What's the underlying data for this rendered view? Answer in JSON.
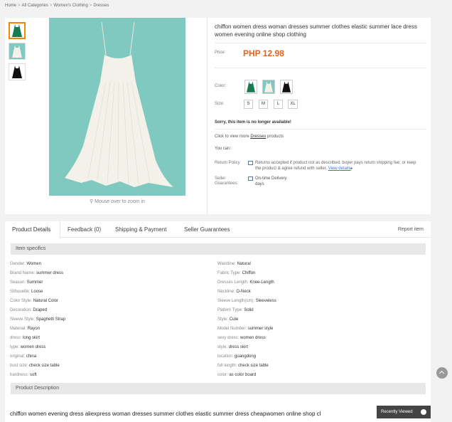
{
  "breadcrumb": {
    "home": "Home",
    "categories": "All Categories",
    "clothing": "Women's Clothing",
    "current": "Dresses",
    "sep": ">"
  },
  "product": {
    "title": "chiffon women dress woman dresses summer clothes elastic summer lace dress women evening online shop clothing",
    "price_label": "Price:",
    "price": "PHP 12.98",
    "color_label": "Color:",
    "size_label": "Size:",
    "sizes": [
      "S",
      "M",
      "L",
      "XL"
    ],
    "unavailable": "Sorry, this item is no longer available!",
    "click_prefix": "Click to view more ",
    "click_link": "Dresses",
    "click_suffix": " products",
    "you_can": "You can:",
    "return_label": "Return Policy",
    "return_text": "Returns accepted if product not as described, buyer pays return shipping fee; or keep the product & agree refund with seller.",
    "view_details": "View details",
    "guarantee_label": "Seller Guarantees:",
    "guarantee_line1": "On-time Delivery",
    "guarantee_line2": "days",
    "zoom_hint": "Mouse over to zoom in"
  },
  "colors": {
    "teal_bg": "#80c9c0",
    "price": "#e8601c",
    "active_border": "#f08a00",
    "link": "#3a7ac8"
  },
  "tabs": {
    "details": "Product Details",
    "feedback": "Feedback (0)",
    "shipping": "Shipping & Payment",
    "guarantees": "Seller Guarantees",
    "report": "Report item"
  },
  "specifics_title": "Item specifics",
  "specs_left": [
    {
      "k": "Gender:",
      "v": "Women"
    },
    {
      "k": "Brand Name:",
      "v": "summer dress"
    },
    {
      "k": "Season:",
      "v": "Summer"
    },
    {
      "k": "Silhouette:",
      "v": "Loose"
    },
    {
      "k": "Color Style:",
      "v": "Natural Color"
    },
    {
      "k": "Decoration:",
      "v": "Draped"
    },
    {
      "k": "Sleeve Style:",
      "v": "Spaghetti Strap"
    },
    {
      "k": "Material:",
      "v": "Rayon"
    },
    {
      "k": "dress:",
      "v": "long skirt"
    },
    {
      "k": "type:",
      "v": "women dress"
    },
    {
      "k": "original:",
      "v": "china"
    },
    {
      "k": "bust size:",
      "v": "check size table"
    },
    {
      "k": "hardness:",
      "v": "soft"
    }
  ],
  "specs_right": [
    {
      "k": "Waistline:",
      "v": "Natural"
    },
    {
      "k": "Fabric Type:",
      "v": "Chiffon"
    },
    {
      "k": "Dresses Length:",
      "v": "Knee-Length"
    },
    {
      "k": "Neckline:",
      "v": "O-Neck"
    },
    {
      "k": "Sleeve Length(cm):",
      "v": "Sleeveless"
    },
    {
      "k": "Pattern Type:",
      "v": "Solid"
    },
    {
      "k": "Style:",
      "v": "Cute"
    },
    {
      "k": "Model Number:",
      "v": "summer style"
    },
    {
      "k": "sexy dress:",
      "v": "women dress"
    },
    {
      "k": "style:",
      "v": "dress skirt"
    },
    {
      "k": "location:",
      "v": "guangdong"
    },
    {
      "k": "full length:",
      "v": "check size table"
    },
    {
      "k": "color:",
      "v": "as color board"
    }
  ],
  "description_title": "Product Description",
  "description_text": "chiffon women evening dress aliexpress woman dresses summer clothes elastic summer dress cheapwomen online shop cl",
  "recently_viewed": "Recently Viewed"
}
